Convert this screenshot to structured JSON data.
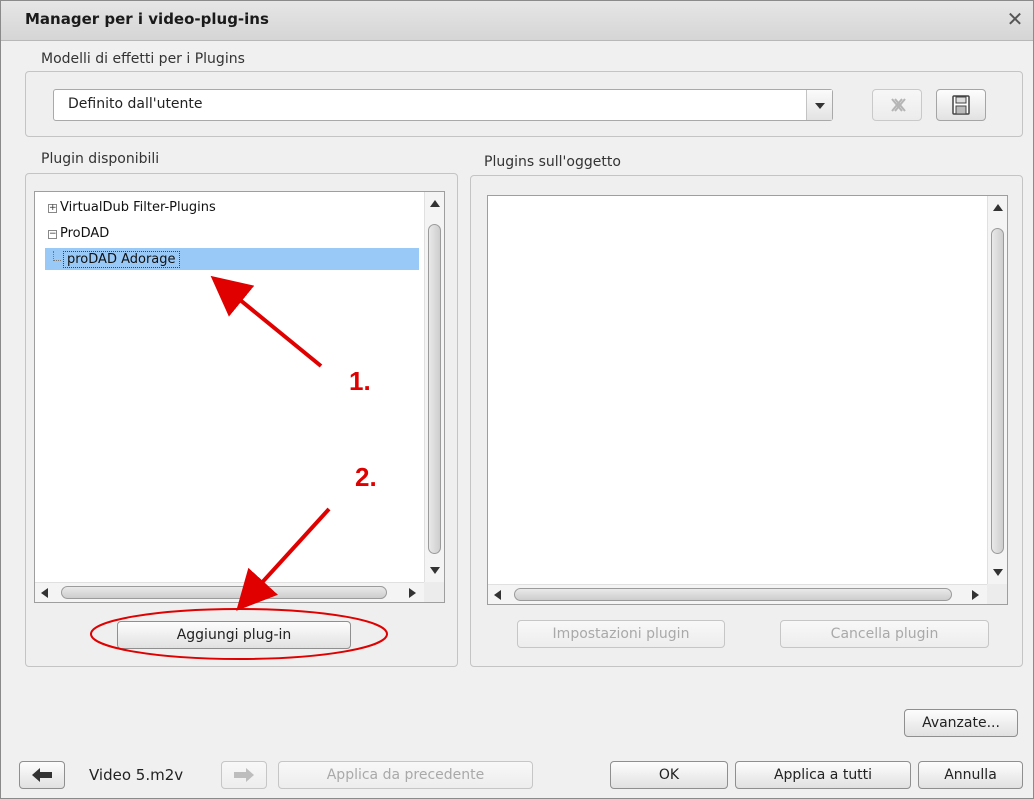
{
  "window": {
    "title": "Manager per i video-plug-ins",
    "close_icon": "close-icon"
  },
  "templates": {
    "group_label": "Modelli di effetti per i Plugins",
    "selected_value": "Definito dall'utente",
    "delete_icon": "delete-template-icon",
    "save_icon": "save-icon"
  },
  "available": {
    "label": "Plugin disponibili",
    "tree": [
      {
        "label": "VirtualDub Filter-Plugins",
        "expander": "+"
      },
      {
        "label": "ProDAD",
        "expander": "−"
      },
      {
        "label": "proDAD Adorage"
      }
    ],
    "add_button": "Aggiungi plug-in"
  },
  "on_object": {
    "label": "Plugins sull'oggetto",
    "settings_button": "Impostazioni plugin",
    "delete_button": "Cancella plugin"
  },
  "advanced_button": "Avanzate...",
  "footer": {
    "prev_icon": "arrow-left-icon",
    "current_object": "Video 5.m2v",
    "next_icon": "arrow-right-icon",
    "apply_previous": "Applica da precedente",
    "ok": "OK",
    "apply_all": "Applica a tutti",
    "cancel": "Annulla"
  },
  "annotations": {
    "step1": "1.",
    "step2": "2.",
    "color": "#e00000"
  }
}
